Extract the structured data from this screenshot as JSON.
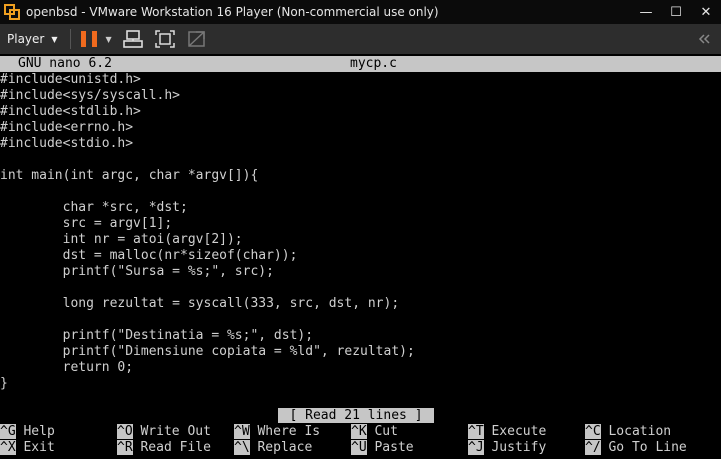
{
  "window": {
    "title": "openbsd - VMware Workstation 16 Player (Non-commercial use only)",
    "controls": {
      "minimize": "—",
      "maximize": "☐",
      "close": "✕"
    }
  },
  "toolbar": {
    "player_label": "Player",
    "icons": [
      "pause-icon",
      "send-ctrl-alt-del-icon",
      "fullscreen-icon",
      "unity-icon",
      "collapse-icon"
    ]
  },
  "nano": {
    "version": "GNU nano 6.2",
    "filename": "mycp.c",
    "code_lines": [
      "#include<unistd.h>",
      "#include<sys/syscall.h>",
      "#include<stdlib.h>",
      "#include<errno.h>",
      "#include<stdio.h>",
      "",
      "int main(int argc, char *argv[]){",
      "",
      "        char *src, *dst;",
      "        src = argv[1];",
      "        int nr = atoi(argv[2]);",
      "        dst = malloc(nr*sizeof(char));",
      "        printf(\"Sursa = %s;\", src);",
      "",
      "        long rezultat = syscall(333, src, dst, nr);",
      "",
      "        printf(\"Destinatia = %s;\", dst);",
      "        printf(\"Dimensiune copiata = %ld\", rezultat);",
      "        return 0;",
      "}"
    ],
    "status_message": "[ Read 21 lines ]",
    "shortcuts_row1": [
      {
        "key": "^G",
        "label": "Help"
      },
      {
        "key": "^O",
        "label": "Write Out"
      },
      {
        "key": "^W",
        "label": "Where Is"
      },
      {
        "key": "^K",
        "label": "Cut"
      },
      {
        "key": "^T",
        "label": "Execute"
      },
      {
        "key": "^C",
        "label": "Location"
      }
    ],
    "shortcuts_row2": [
      {
        "key": "^X",
        "label": "Exit"
      },
      {
        "key": "^R",
        "label": "Read File"
      },
      {
        "key": "^\\",
        "label": "Replace"
      },
      {
        "key": "^U",
        "label": "Paste"
      },
      {
        "key": "^J",
        "label": "Justify"
      },
      {
        "key": "^/",
        "label": "Go To Line"
      }
    ]
  }
}
